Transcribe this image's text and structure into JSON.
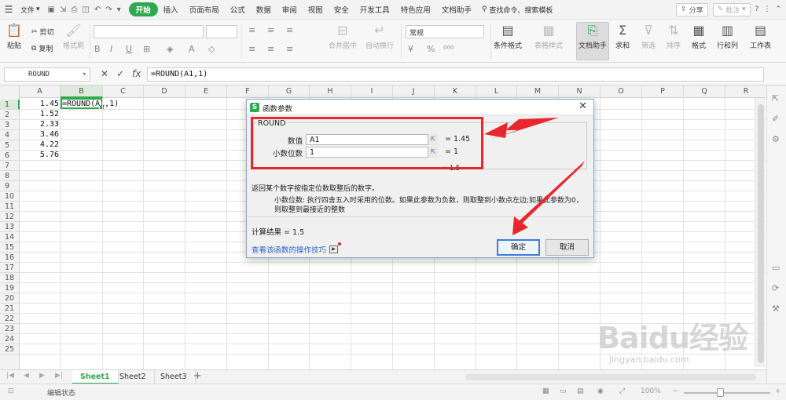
{
  "menubar": {
    "file_label": "文件",
    "tabs": [
      {
        "label": "开始",
        "active": true
      },
      {
        "label": "插入"
      },
      {
        "label": "页面布局"
      },
      {
        "label": "公式"
      },
      {
        "label": "数据"
      },
      {
        "label": "审阅"
      },
      {
        "label": "视图"
      },
      {
        "label": "安全"
      },
      {
        "label": "开发工具"
      },
      {
        "label": "特色应用"
      },
      {
        "label": "文档助手"
      }
    ],
    "search_label": "查找命令、搜索模板",
    "share_label": "分享",
    "annotate_label": "批注"
  },
  "ribbon": {
    "paste": "粘贴",
    "cut": "剪切",
    "copy": "复制",
    "format_painter": "格式刷",
    "merge_center": "合并居中",
    "auto_wrap": "自动换行",
    "number_format": "常规",
    "conditional_format": "条件格式",
    "table_style": "表格样式",
    "doc_helper": "文档助手",
    "sum": "求和",
    "filter": "筛选",
    "sort": "排序",
    "format": "格式",
    "row_col": "行和列",
    "worksheet": "工作表"
  },
  "formula_bar": {
    "name_box": "ROUND",
    "formula": "=ROUND(A1,1)"
  },
  "grid": {
    "columns": [
      "A",
      "B",
      "C",
      "D",
      "E",
      "F",
      "G",
      "H",
      "I",
      "J",
      "K",
      "L",
      "M",
      "N",
      "O",
      "P",
      "Q",
      "R"
    ],
    "rows": [
      "1",
      "2",
      "3",
      "4",
      "5",
      "6",
      "7",
      "8",
      "9",
      "10",
      "11",
      "12",
      "13",
      "14",
      "15",
      "16",
      "17",
      "18",
      "19",
      "20",
      "21",
      "22",
      "23",
      "24",
      "25"
    ],
    "a_values": [
      "1.45",
      "1.52",
      "2.33",
      "3.46",
      "4.22",
      "5.76"
    ],
    "b1_formula": "=ROUND(A1,1)",
    "active_column": "B",
    "active_row": "1"
  },
  "dialog": {
    "title": "函数参数",
    "function_name": "ROUND",
    "args": [
      {
        "label": "数值",
        "value": "A1",
        "eval": "= 1.45"
      },
      {
        "label": "小数位数",
        "value": "1",
        "eval": "= 1"
      }
    ],
    "result_partial": "= 1.5",
    "description": "返回某个数字按指定位数取整后的数字。",
    "arg_help_label": "小数位数:",
    "arg_help_text": "执行四舍五入时采用的位数。如果此参数为负数，则取整到小数点左边;如果此参数为0，则取整到最接近的整数",
    "calc_result": "计算结果 = 1.5",
    "help_link": "查看该函数的操作技巧",
    "ok_label": "确定",
    "cancel_label": "取消"
  },
  "sheets": [
    {
      "label": "Sheet1",
      "active": true
    },
    {
      "label": "Sheet2"
    },
    {
      "label": "Sheet3"
    }
  ],
  "status": {
    "edit_status": "编辑状态",
    "zoom": "100%"
  },
  "watermark": {
    "brand": "Baidu经验",
    "url": "jingyan.baidu.com"
  },
  "colors": {
    "accent": "#2fa84f",
    "annotation": "#e8262d",
    "link": "#2a64c5"
  }
}
